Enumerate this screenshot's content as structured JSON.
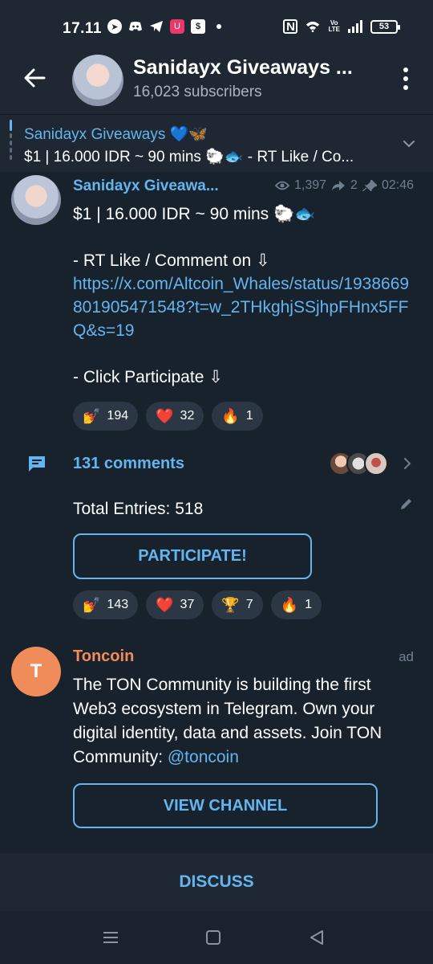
{
  "status_bar": {
    "time": "17.11",
    "battery": "53",
    "icons": [
      "telegram-icon",
      "discord-icon",
      "telegram-icon",
      "app-icon",
      "shop-icon",
      "nfc-icon",
      "wifi-icon",
      "volte-icon",
      "signal-icon",
      "battery-icon"
    ],
    "volte_line1": "Vo",
    "volte_line2": "LTE",
    "app_badge": "U",
    "shop_badge": "$"
  },
  "header": {
    "title": "Sanidayx Giveaways ...",
    "subtitle": "16,023 subscribers"
  },
  "pinned": {
    "title": "Sanidayx Giveaways 💙🦋",
    "text": "$1 | 16.000 IDR ~ 90 mins 🐑🐟 - RT Like / Co..."
  },
  "message": {
    "author": "Sanidayx Giveawa...",
    "views": "1,397",
    "forwards": "2",
    "time": "02:46",
    "line1": "$1 | 16.000 IDR ~ 90 mins 🐑🐟",
    "line2": "- RT Like / Comment on  ⇩",
    "link": "https://x.com/Altcoin_Whales/status/1938669801905471548?t=w_2THkghjSSjhpFHnx5FFQ&s=19",
    "line3": "- Click Participate ⇩",
    "reactions": [
      {
        "emoji": "💅",
        "count": "194"
      },
      {
        "emoji": "❤️",
        "count": "32"
      },
      {
        "emoji": "🔥",
        "count": "1"
      }
    ],
    "comments_label": "131 comments"
  },
  "giveaway": {
    "entries": "Total Entries: 518",
    "button": "PARTICIPATE!",
    "reactions": [
      {
        "emoji": "💅",
        "count": "143"
      },
      {
        "emoji": "❤️",
        "count": "37"
      },
      {
        "emoji": "🏆",
        "count": "7"
      },
      {
        "emoji": "🔥",
        "count": "1"
      }
    ]
  },
  "ad": {
    "initial": "T",
    "author": "Toncoin",
    "tag": "ad",
    "text": "The TON Community is building the first Web3 ecosystem in Telegram. Own your digital identity, data and assets. Join TON Community: ",
    "mention": "@toncoin",
    "button": "VIEW CHANNEL"
  },
  "discuss": "DISCUSS",
  "colors": {
    "accent": "#64b5ef",
    "background": "#18222d",
    "bar": "#1e2732",
    "ad_accent": "#ef8c59"
  }
}
